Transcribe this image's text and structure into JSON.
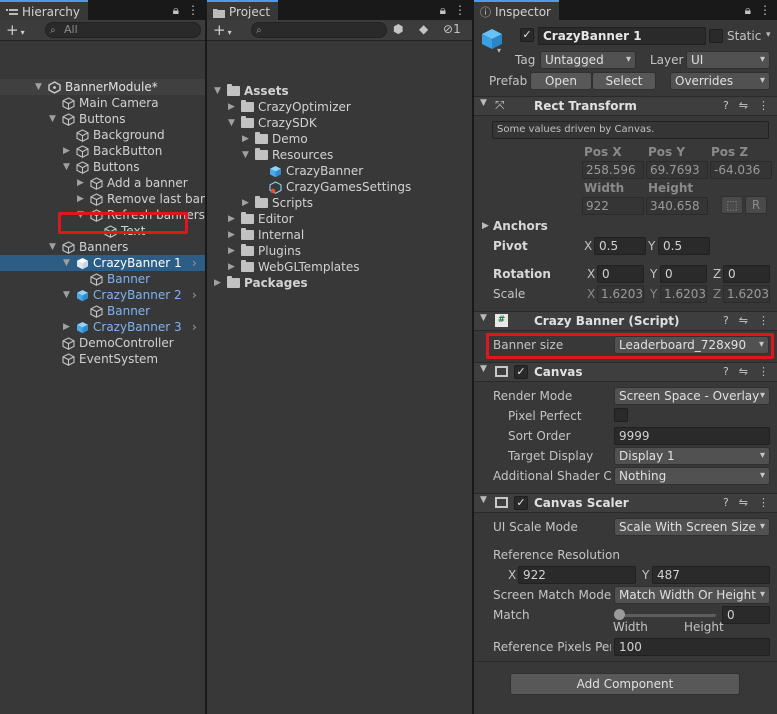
{
  "hierarchy": {
    "tab_label": "Hierarchy",
    "search_placeholder": "All",
    "items": [
      {
        "label": "BannerModule*",
        "indent": 0,
        "arrow": "down",
        "icon": "unity",
        "kind": "scene"
      },
      {
        "label": "Main Camera",
        "indent": 1,
        "arrow": "",
        "icon": "cube",
        "kind": "normal"
      },
      {
        "label": "Buttons",
        "indent": 1,
        "arrow": "down",
        "icon": "cube",
        "kind": "normal"
      },
      {
        "label": "Background",
        "indent": 2,
        "arrow": "",
        "icon": "cube",
        "kind": "normal"
      },
      {
        "label": "BackButton",
        "indent": 2,
        "arrow": "right",
        "icon": "cube",
        "kind": "normal"
      },
      {
        "label": "Buttons",
        "indent": 2,
        "arrow": "down",
        "icon": "cube",
        "kind": "normal"
      },
      {
        "label": "Add a banner",
        "indent": 3,
        "arrow": "right",
        "icon": "cube",
        "kind": "normal"
      },
      {
        "label": "Remove last banner",
        "indent": 3,
        "arrow": "right",
        "icon": "cube",
        "kind": "normal"
      },
      {
        "label": "Refresh banners",
        "indent": 3,
        "arrow": "down",
        "icon": "cube",
        "kind": "normal"
      },
      {
        "label": "Text",
        "indent": 4,
        "arrow": "",
        "icon": "cube",
        "kind": "normal"
      },
      {
        "label": "Banners",
        "indent": 1,
        "arrow": "down",
        "icon": "cube",
        "kind": "normal"
      },
      {
        "label": "CrazyBanner 1",
        "indent": 2,
        "arrow": "down",
        "icon": "prefab",
        "kind": "selected",
        "chevron": true
      },
      {
        "label": "Banner",
        "indent": 3,
        "arrow": "",
        "icon": "cube",
        "kind": "prefab-child"
      },
      {
        "label": "CrazyBanner 2",
        "indent": 2,
        "arrow": "down",
        "icon": "prefab",
        "kind": "prefab",
        "chevron": true
      },
      {
        "label": "Banner",
        "indent": 3,
        "arrow": "",
        "icon": "cube",
        "kind": "prefab-child"
      },
      {
        "label": "CrazyBanner 3",
        "indent": 2,
        "arrow": "right",
        "icon": "prefab",
        "kind": "prefab",
        "chevron": true
      },
      {
        "label": "DemoController",
        "indent": 1,
        "arrow": "",
        "icon": "cube",
        "kind": "normal"
      },
      {
        "label": "EventSystem",
        "indent": 1,
        "arrow": "",
        "icon": "cube",
        "kind": "normal"
      }
    ]
  },
  "project": {
    "tab_label": "Project",
    "search_placeholder": "",
    "hidden_count": "1",
    "items": [
      {
        "label": "Assets",
        "indent": 0,
        "arrow": "down",
        "icon": "folder",
        "bold": true
      },
      {
        "label": "CrazyOptimizer",
        "indent": 1,
        "arrow": "right",
        "icon": "folder"
      },
      {
        "label": "CrazySDK",
        "indent": 1,
        "arrow": "down",
        "icon": "folder"
      },
      {
        "label": "Demo",
        "indent": 2,
        "arrow": "right",
        "icon": "folder"
      },
      {
        "label": "Resources",
        "indent": 2,
        "arrow": "down",
        "icon": "folder"
      },
      {
        "label": "CrazyBanner",
        "indent": 3,
        "arrow": "",
        "icon": "prefab"
      },
      {
        "label": "CrazyGamesSettings",
        "indent": 3,
        "arrow": "",
        "icon": "settings"
      },
      {
        "label": "Scripts",
        "indent": 2,
        "arrow": "right",
        "icon": "folder"
      },
      {
        "label": "Editor",
        "indent": 1,
        "arrow": "right",
        "icon": "folder"
      },
      {
        "label": "Internal",
        "indent": 1,
        "arrow": "right",
        "icon": "folder"
      },
      {
        "label": "Plugins",
        "indent": 1,
        "arrow": "right",
        "icon": "folder"
      },
      {
        "label": "WebGLTemplates",
        "indent": 1,
        "arrow": "right",
        "icon": "folder"
      },
      {
        "label": "Packages",
        "indent": 0,
        "arrow": "right",
        "icon": "folder",
        "bold": true
      }
    ]
  },
  "inspector": {
    "tab_label": "Inspector",
    "object_name": "CrazyBanner 1",
    "static_label": "Static",
    "tag_label": "Tag",
    "tag_value": "Untagged",
    "layer_label": "Layer",
    "layer_value": "UI",
    "prefab_label": "Prefab",
    "open_label": "Open",
    "select_label": "Select",
    "overrides_label": "Overrides",
    "rect_transform": {
      "title": "Rect Transform",
      "note": "Some values driven by Canvas.",
      "posx_label": "Pos X",
      "posy_label": "Pos Y",
      "posz_label": "Pos Z",
      "posx": "258.596",
      "posy": "69.7693",
      "posz": "-64.036",
      "width_label": "Width",
      "height_label": "Height",
      "width": "922",
      "height": "340.658",
      "r_button": "R",
      "anchors_label": "Anchors",
      "pivot_label": "Pivot",
      "pivot_x": "0.5",
      "pivot_y": "0.5",
      "rotation_label": "Rotation",
      "rot_x": "0",
      "rot_y": "0",
      "rot_z": "0",
      "scale_label": "Scale",
      "scale_x": "1.62039",
      "scale_y": "1.62039",
      "scale_z": "1.62039",
      "x_axis": "X",
      "y_axis": "Y",
      "z_axis": "Z"
    },
    "crazy_banner": {
      "title": "Crazy Banner (Script)",
      "banner_size_label": "Banner size",
      "banner_size_value": "Leaderboard_728x90"
    },
    "canvas": {
      "title": "Canvas",
      "render_mode_label": "Render Mode",
      "render_mode_value": "Screen Space - Overlay",
      "pixel_perfect_label": "Pixel Perfect",
      "sort_order_label": "Sort Order",
      "sort_order_value": "9999",
      "target_display_label": "Target Display",
      "target_display_value": "Display 1",
      "shader_channels_label": "Additional Shader Channels",
      "shader_channels_value": "Nothing"
    },
    "canvas_scaler": {
      "title": "Canvas Scaler",
      "ui_scale_mode_label": "UI Scale Mode",
      "ui_scale_mode_value": "Scale With Screen Size",
      "ref_res_label": "Reference Resolution",
      "ref_x_label": "X",
      "ref_x": "922",
      "ref_y_label": "Y",
      "ref_y": "487",
      "match_mode_label": "Screen Match Mode",
      "match_mode_value": "Match Width Or Height",
      "match_label": "Match",
      "match_value": "0",
      "width_label": "Width",
      "height_label": "Height",
      "ref_pixels_label": "Reference Pixels Per Unit",
      "ref_pixels_value": "100"
    },
    "add_component_label": "Add Component"
  }
}
